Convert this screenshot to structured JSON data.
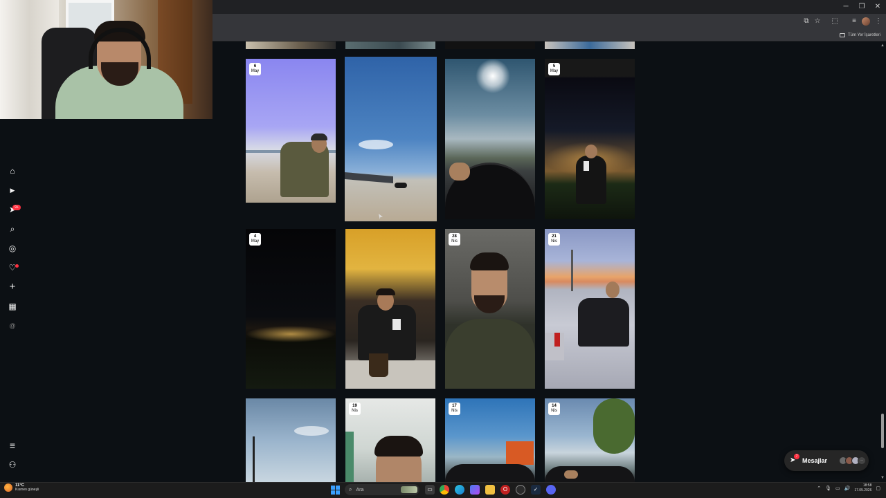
{
  "browser": {
    "window_controls": [
      "─",
      "❐",
      "✕"
    ],
    "bookmarks_folder": "Tüm Yer İşaretleri"
  },
  "left_nav": {
    "items": [
      {
        "name": "home-icon",
        "glyph": "⌂"
      },
      {
        "name": "reels-icon",
        "glyph": "▶"
      },
      {
        "name": "direct-icon",
        "glyph": "➤",
        "badge": "9+"
      },
      {
        "name": "search-icon",
        "glyph": "⌕"
      },
      {
        "name": "explore-icon",
        "glyph": "◎"
      },
      {
        "name": "heart-icon",
        "glyph": "♡"
      },
      {
        "name": "create-icon",
        "glyph": "+"
      },
      {
        "name": "dashboard-icon",
        "glyph": "▦"
      },
      {
        "name": "threads-icon",
        "glyph": "@"
      }
    ],
    "bottom": [
      {
        "name": "menu-icon",
        "glyph": "≡"
      },
      {
        "name": "meta-icon",
        "glyph": "⚇"
      }
    ]
  },
  "grid": {
    "row1": [
      {
        "day": "6",
        "month": "May"
      },
      {
        "day": "",
        "month": ""
      },
      {
        "day": "",
        "month": ""
      },
      {
        "day": "5",
        "month": "May"
      }
    ],
    "row2": [
      {
        "day": "4",
        "month": "May"
      },
      {
        "day": "",
        "month": ""
      },
      {
        "day": "28",
        "month": "Nis"
      },
      {
        "day": "21",
        "month": "Nis"
      }
    ],
    "row3": [
      {
        "day": "",
        "month": ""
      },
      {
        "day": "19",
        "month": "Nis"
      },
      {
        "day": "17",
        "month": "Nis"
      },
      {
        "day": "14",
        "month": "Nis"
      }
    ]
  },
  "messages": {
    "label": "Mesajlar",
    "badge": "7"
  },
  "taskbar": {
    "weather_temp": "11°C",
    "weather_desc": "Kısmen güneşli",
    "search_placeholder": "Ara",
    "time": "18:58",
    "date": "17.05.2026"
  }
}
